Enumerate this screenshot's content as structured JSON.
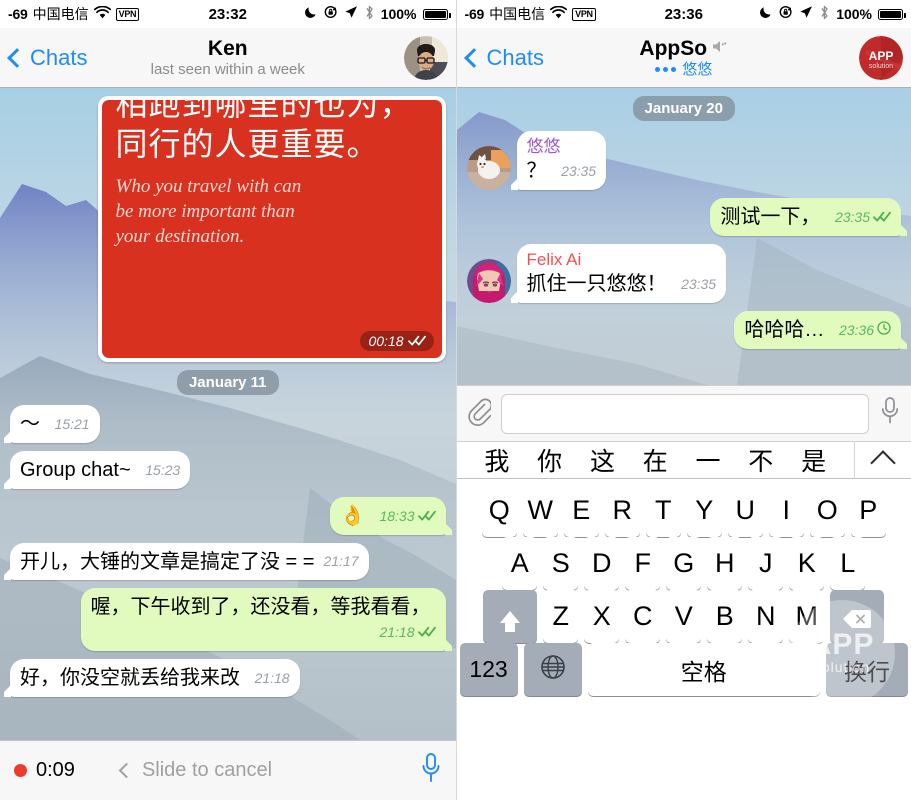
{
  "left": {
    "status_bar": {
      "signal": "-69",
      "carrier": "中国电信",
      "wifi_icon": "wifi-icon",
      "vpn_label": "VPN",
      "time": "23:32",
      "dnd_icon": "moon-icon",
      "rotation_lock_icon": "rotation-lock-icon",
      "location_icon": "location-arrow-icon",
      "bluetooth_icon": "bluetooth-icon",
      "battery_pct": "100%",
      "battery_icon": "battery-full-icon"
    },
    "nav": {
      "back_label": "Chats",
      "title": "Ken",
      "subtitle": "last seen within a week",
      "avatar_name": "contact-avatar-ken"
    },
    "photo_message": {
      "cn_line1": "相跑到哪里的也为，",
      "cn_line2": "同行的人更重要。",
      "en_line1": "Who you travel with can",
      "en_line2": "be more important than",
      "en_line3": "your destination.",
      "time": "00:18",
      "ticks": "double-check"
    },
    "day_divider": "January 11",
    "messages": [
      {
        "dir": "in",
        "text": "〜",
        "time": "15:21"
      },
      {
        "dir": "in",
        "text": "Group chat~",
        "time": "15:23"
      },
      {
        "dir": "out",
        "text": "👌",
        "time": "18:33",
        "ticks": "double-check"
      },
      {
        "dir": "in",
        "text": "开儿，大锤的文章是搞定了没 = =",
        "time": "21:17"
      },
      {
        "dir": "out",
        "text": "喔，下午收到了，还没看，等我看看，",
        "time": "21:18",
        "ticks": "double-check"
      },
      {
        "dir": "in",
        "text": "好，你没空就丢给我来改",
        "time": "21:18"
      }
    ],
    "record_bar": {
      "rec_dot": "recording-indicator",
      "elapsed": "0:09",
      "slide_label": "Slide to cancel",
      "mic_icon": "microphone-icon"
    }
  },
  "right": {
    "status_bar": {
      "signal": "-69",
      "carrier": "中国电信",
      "wifi_icon": "wifi-icon",
      "vpn_label": "VPN",
      "time": "23:36",
      "dnd_icon": "moon-icon",
      "rotation_lock_icon": "rotation-lock-icon",
      "location_icon": "location-arrow-icon",
      "bluetooth_icon": "bluetooth-icon",
      "battery_pct": "100%",
      "battery_icon": "battery-full-icon"
    },
    "nav": {
      "back_label": "Chats",
      "title": "AppSo",
      "mute_icon": "mute-speaker-icon",
      "typing_dots_icon": "typing-dots-icon",
      "typing_user": "悠悠",
      "avatar_name": "group-avatar-appsolution",
      "avatar_line1": "APP",
      "avatar_line2": "solution"
    },
    "day_divider": "January 20",
    "messages": [
      {
        "dir": "in",
        "sender": "悠悠",
        "sender_color": "#9b59d0",
        "text": "？",
        "time": "23:35",
        "avatar": "avatar-youyou"
      },
      {
        "dir": "out",
        "text": "测试一下，",
        "time": "23:35",
        "ticks": "double-check"
      },
      {
        "dir": "in",
        "sender": "Felix Ai",
        "sender_color": "#ef5350",
        "text": "抓住一只悠悠！",
        "time": "23:35",
        "avatar": "avatar-felix-ai"
      },
      {
        "dir": "out",
        "text": "哈哈哈…",
        "time": "23:36",
        "ticks": "clock-pending"
      }
    ],
    "input_bar": {
      "attach_icon": "paperclip-icon",
      "field_value": "",
      "field_placeholder": "",
      "mic_icon": "microphone-icon"
    },
    "keyboard": {
      "suggestions": [
        "我",
        "你",
        "这",
        "在",
        "一",
        "不",
        "是"
      ],
      "collapse_icon": "chevron-up-icon",
      "row1": [
        "Q",
        "W",
        "E",
        "R",
        "T",
        "Y",
        "U",
        "I",
        "O",
        "P"
      ],
      "row2": [
        "A",
        "S",
        "D",
        "F",
        "G",
        "H",
        "J",
        "K",
        "L"
      ],
      "row3": [
        "Z",
        "X",
        "C",
        "V",
        "B",
        "N",
        "M"
      ],
      "shift_icon": "shift-icon",
      "backspace_icon": "backspace-icon",
      "numeric_label": "123",
      "globe_icon": "globe-icon",
      "space_label": "空格",
      "return_label": "换行"
    },
    "watermark": {
      "line1": "APP",
      "line2": "solution"
    }
  }
}
